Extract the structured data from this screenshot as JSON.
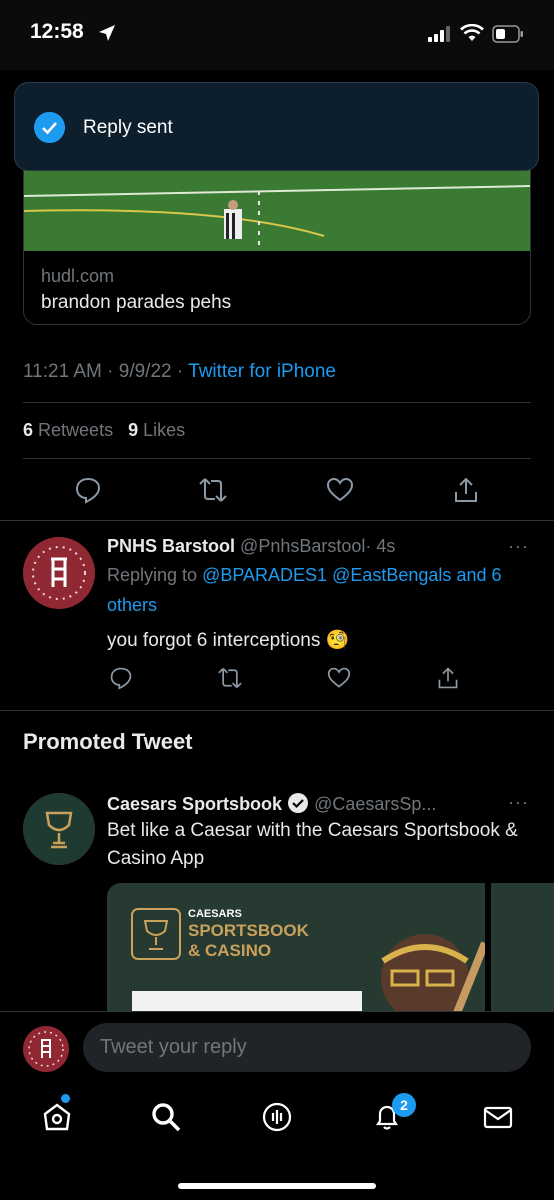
{
  "status_bar": {
    "time": "12:58"
  },
  "toast": {
    "text": "Reply sent"
  },
  "link_card": {
    "domain": "hudl.com",
    "title": "brandon parades pehs"
  },
  "tweet_meta": {
    "time": "11:21 AM",
    "separator": "·",
    "date": "9/9/22",
    "source": "Twitter for iPhone"
  },
  "stats": {
    "retweets_count": "6",
    "retweets_label": "Retweets",
    "likes_count": "9",
    "likes_label": "Likes"
  },
  "reply_tweet": {
    "name": "PNHS Barstool",
    "handle": "@PnhsBarstool",
    "time": "· 4s",
    "more": "···",
    "replying_prefix": "Replying to",
    "replying_user1": "@BPARADES1",
    "replying_user2": "@EastBengals",
    "replying_others": "and 6 others",
    "text": "you forgot 6 interceptions 🧐"
  },
  "promoted": {
    "section_title": "Promoted Tweet",
    "name": "Caesars Sportsbook",
    "handle": "@CaesarsSp...",
    "more": "···",
    "text": "Bet like a Caesar with the Caesars Sportsbook & Casino App",
    "media_brand_top": "CAESARS",
    "media_brand_1": "SPORTSBOOK",
    "media_brand_2": "& CASINO"
  },
  "reply_bar": {
    "placeholder": "Tweet your reply"
  },
  "tabbar": {
    "notification_badge": "2"
  },
  "colors": {
    "accent": "#1d9bf0",
    "background": "#000000",
    "muted": "#71767b",
    "avatar_red": "#8f2832",
    "caesars_green": "#263a31"
  }
}
